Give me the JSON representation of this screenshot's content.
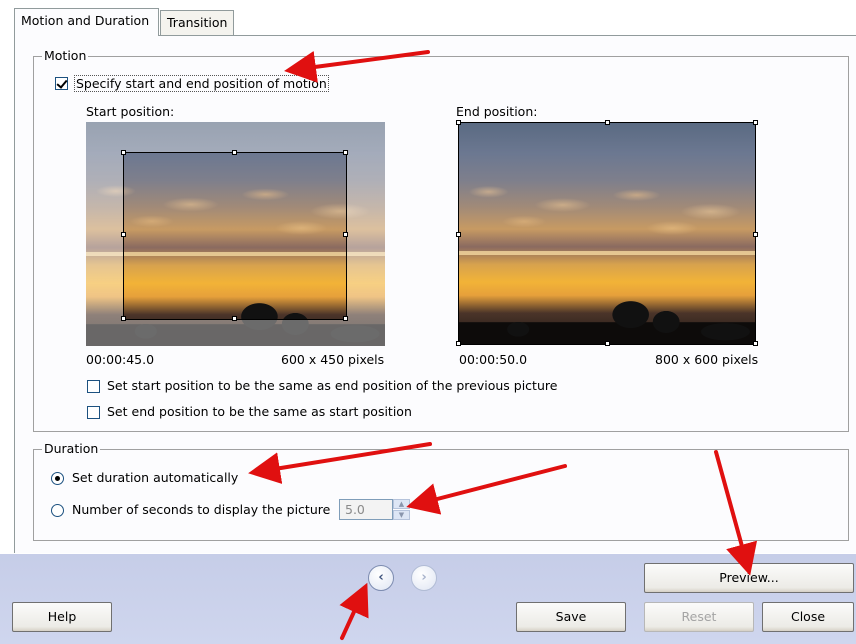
{
  "tabs": [
    {
      "label": "Motion and Duration",
      "active": true
    },
    {
      "label": "Transition",
      "active": false
    }
  ],
  "motion": {
    "group_title": "Motion",
    "specify_checkbox": {
      "label": "Specify start and end position of motion",
      "checked": true
    },
    "start": {
      "heading": "Start position:",
      "time": "00:00:45.0",
      "size": "600 x 450 pixels"
    },
    "end": {
      "heading": "End position:",
      "time": "00:00:50.0",
      "size": "800 x 600 pixels"
    },
    "same_as_previous": {
      "label": "Set start position to be the same as end position of the previous picture",
      "checked": false
    },
    "same_as_start": {
      "label": "Set end position to be the same as start position",
      "checked": false
    }
  },
  "duration": {
    "group_title": "Duration",
    "auto": {
      "label": "Set duration automatically",
      "selected": true
    },
    "manual": {
      "label": "Number of seconds to display the picture",
      "selected": false,
      "value": "5.0"
    }
  },
  "buttons": {
    "preview": "Preview...",
    "help": "Help",
    "save": "Save",
    "reset": "Reset",
    "close": "Close"
  },
  "nav": {
    "prev_icon": "chevron-left-icon",
    "next_icon": "chevron-right-icon"
  },
  "colors": {
    "annotation_arrow": "#e01010",
    "bottom_bar": "#c6cde8"
  }
}
